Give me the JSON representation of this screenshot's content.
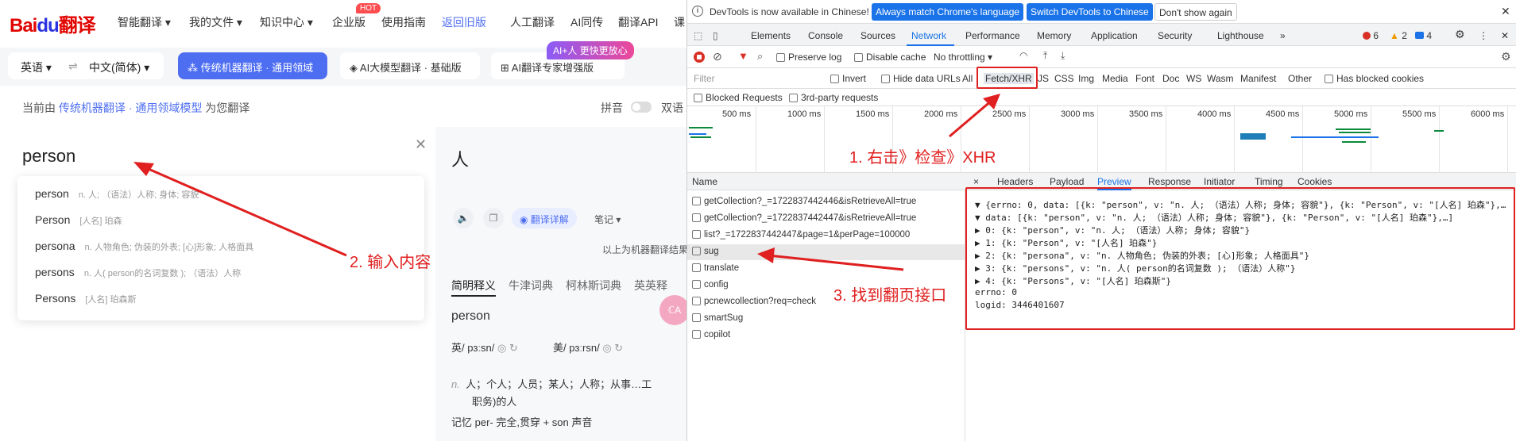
{
  "baidu": {
    "logo_a": "Bai",
    "logo_b": "du",
    "logo_c": "翻译",
    "nav": [
      "智能翻译 ▾",
      "我的文件 ▾",
      "知识中心 ▾",
      "企业版",
      "使用指南",
      "返回旧版",
      "人工翻译",
      "AI同传",
      "翻译API",
      "课"
    ],
    "hot": "HOT",
    "ai_badge": "AI+人 更快更放心",
    "lang_from": "英语 ▾",
    "swap": "⇌",
    "lang_to": "中文(简体) ▾",
    "mode_active": "⁂ 传统机器翻译 · 通用领域",
    "mode_2": "◈ AI大模型翻译 · 基础版",
    "mode_3": "⊞ AI翻译专家增强版",
    "info_prefix": "当前由",
    "info_link": "传统机器翻译 · 通用领域模型",
    "info_suffix": "为您翻译",
    "pinyin": "拼音",
    "bilingual": "双语",
    "input_text": "person",
    "suggestions": [
      {
        "word": "person",
        "def": "n. 人; （语法）人称; 身体; 容貌"
      },
      {
        "word": "Person",
        "def": "[人名] 珀森"
      },
      {
        "word": "persona",
        "def": "n. 人物角色; 伪装的外表; [心]形象; 人格面具"
      },
      {
        "word": "persons",
        "def": "n. 人( person的名词复数 ); （语法）人称"
      },
      {
        "word": "Persons",
        "def": "[人名] 珀森斯"
      }
    ],
    "result": "人",
    "detail_btn": "◉ 翻译详解",
    "note_btn": "笔记 ▾",
    "machine_note": "以上为机器翻译结果",
    "dict_tabs": [
      "简明释义",
      "牛津词典",
      "柯林斯词典",
      "英英释"
    ],
    "dict_word": "person",
    "phon_uk": "英/ pɜːsn/",
    "phon_us": "美/ pɜːrsn/",
    "def_pos": "n.",
    "def_text": "人；个人；人员；某人；人称；从事…工",
    "def_text2": "职务)的人",
    "memory": "记忆  per- 完全,贯穿 + son 声音"
  },
  "annotations": {
    "step1": "1. 右击》检查》XHR",
    "step2": "2. 输入内容",
    "step3": "3. 找到翻页接口"
  },
  "devtools": {
    "banner_text": "DevTools is now available in Chinese!",
    "btn_match": "Always match Chrome's language",
    "btn_switch": "Switch DevTools to Chinese",
    "btn_dont": "Don't show again",
    "tabs": [
      "Elements",
      "Console",
      "Sources",
      "Network",
      "Performance",
      "Memory",
      "Application",
      "Security",
      "Lighthouse",
      "»"
    ],
    "errors": "6",
    "warnings": "2",
    "infos": "4",
    "preserve_log": "Preserve log",
    "disable_cache": "Disable cache",
    "throttling": "No throttling ▾",
    "filter_placeholder": "Filter",
    "invert": "Invert",
    "hide_data": "Hide data URLs",
    "types": [
      "All",
      "Fetch/XHR",
      "JS",
      "CSS",
      "Img",
      "Media",
      "Font",
      "Doc",
      "WS",
      "Wasm",
      "Manifest",
      "Other"
    ],
    "blocked_cookies": "Has blocked cookies",
    "blocked_requests": "Blocked Requests",
    "third_party": "3rd-party requests",
    "ticks": [
      "500 ms",
      "1000 ms",
      "1500 ms",
      "2000 ms",
      "2500 ms",
      "3000 ms",
      "3500 ms",
      "4000 ms",
      "4500 ms",
      "5000 ms",
      "5500 ms",
      "6000 ms"
    ],
    "name_header": "Name",
    "requests": [
      "getCollection?_=1722837442446&isRetrieveAll=true",
      "getCollection?_=1722837442447&isRetrieveAll=true",
      "list?_=1722837442447&page=1&perPage=100000",
      "sug",
      "translate",
      "config",
      "pcnewcollection?req=check",
      "smartSug",
      "copilot"
    ],
    "preview_tabs": [
      "×",
      "Headers",
      "Payload",
      "Preview",
      "Response",
      "Initiator",
      "Timing",
      "Cookies"
    ],
    "json_lines": [
      "▼ {errno: 0, data: [{k: \"person\", v: \"n. 人; （语法）人称; 身体; 容貌\"}, {k: \"Person\", v: \"[人名] 珀森\"},…",
      "  ▼ data: [{k: \"person\", v: \"n. 人; （语法）人称; 身体; 容貌\"}, {k: \"Person\", v: \"[人名] 珀森\"},…]",
      "    ▶ 0: {k: \"person\", v: \"n. 人; （语法）人称; 身体; 容貌\"}",
      "    ▶ 1: {k: \"Person\", v: \"[人名] 珀森\"}",
      "    ▶ 2: {k: \"persona\", v: \"n. 人物角色; 伪装的外表; [心]形象; 人格面具\"}",
      "    ▶ 3: {k: \"persons\", v: \"n. 人( person的名词复数 ); （语法）人称\"}",
      "    ▶ 4: {k: \"Persons\", v: \"[人名] 珀森斯\"}",
      "    errno: 0",
      "    logid: 3446401607"
    ]
  }
}
